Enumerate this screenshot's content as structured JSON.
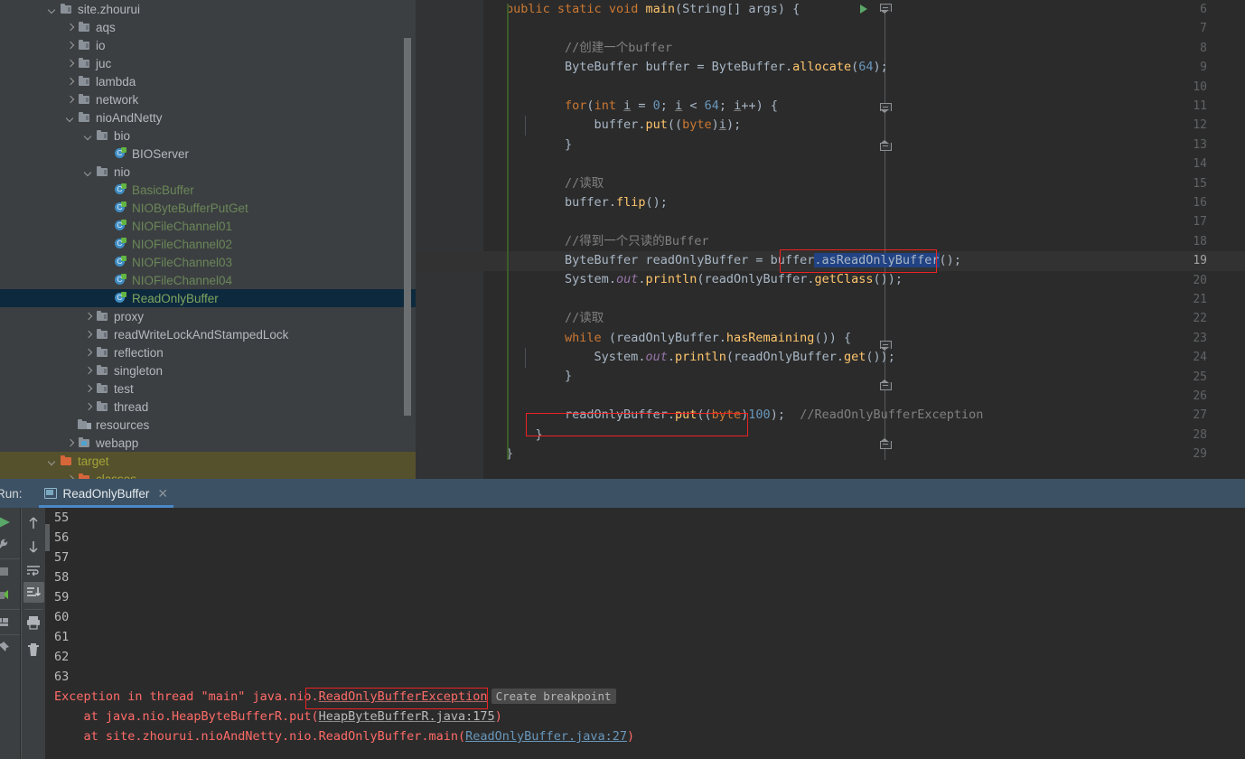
{
  "sidebar": {
    "scrollbar": "vertical-scrollbar",
    "items": [
      {
        "label": "site.zhourui",
        "indent": 0,
        "arrow": "down",
        "icon": "folder-icon",
        "kind": "folder"
      },
      {
        "label": "aqs",
        "indent": 1,
        "arrow": "right",
        "icon": "folder-icon",
        "kind": "folder"
      },
      {
        "label": "io",
        "indent": 1,
        "arrow": "right",
        "icon": "folder-icon",
        "kind": "folder"
      },
      {
        "label": "juc",
        "indent": 1,
        "arrow": "right",
        "icon": "folder-icon",
        "kind": "folder"
      },
      {
        "label": "lambda",
        "indent": 1,
        "arrow": "right",
        "icon": "folder-icon",
        "kind": "folder"
      },
      {
        "label": "network",
        "indent": 1,
        "arrow": "right",
        "icon": "folder-icon",
        "kind": "folder"
      },
      {
        "label": "nioAndNetty",
        "indent": 1,
        "arrow": "down",
        "icon": "folder-icon",
        "kind": "folder"
      },
      {
        "label": "bio",
        "indent": 2,
        "arrow": "down",
        "icon": "folder-icon",
        "kind": "folder"
      },
      {
        "label": "BIOServer",
        "indent": 3,
        "arrow": "none",
        "icon": "java-class-icon",
        "kind": "class"
      },
      {
        "label": "nio",
        "indent": 2,
        "arrow": "down",
        "icon": "folder-icon",
        "kind": "folder"
      },
      {
        "label": "BasicBuffer",
        "indent": 3,
        "arrow": "none",
        "icon": "java-class-icon",
        "kind": "class-green"
      },
      {
        "label": "NIOByteBufferPutGet",
        "indent": 3,
        "arrow": "none",
        "icon": "java-class-icon",
        "kind": "class-green"
      },
      {
        "label": "NIOFileChannel01",
        "indent": 3,
        "arrow": "none",
        "icon": "java-class-icon",
        "kind": "class-green"
      },
      {
        "label": "NIOFileChannel02",
        "indent": 3,
        "arrow": "none",
        "icon": "java-class-icon",
        "kind": "class-green"
      },
      {
        "label": "NIOFileChannel03",
        "indent": 3,
        "arrow": "none",
        "icon": "java-class-icon",
        "kind": "class-green"
      },
      {
        "label": "NIOFileChannel04",
        "indent": 3,
        "arrow": "none",
        "icon": "java-class-icon",
        "kind": "class-green"
      },
      {
        "label": "ReadOnlyBuffer",
        "indent": 3,
        "arrow": "none",
        "icon": "java-class-icon",
        "kind": "class-green",
        "selected": true
      },
      {
        "label": "proxy",
        "indent": 2,
        "arrow": "right",
        "icon": "folder-icon",
        "kind": "folder"
      },
      {
        "label": "readWriteLockAndStampedLock",
        "indent": 2,
        "arrow": "right",
        "icon": "folder-icon",
        "kind": "folder"
      },
      {
        "label": "reflection",
        "indent": 2,
        "arrow": "right",
        "icon": "folder-icon",
        "kind": "folder"
      },
      {
        "label": "singleton",
        "indent": 2,
        "arrow": "right",
        "icon": "folder-icon",
        "kind": "folder"
      },
      {
        "label": "test",
        "indent": 2,
        "arrow": "right",
        "icon": "folder-icon",
        "kind": "folder"
      },
      {
        "label": "thread",
        "indent": 2,
        "arrow": "right",
        "icon": "folder-icon",
        "kind": "folder"
      },
      {
        "label": "resources",
        "indent": 1,
        "arrow": "none",
        "icon": "resources-folder-icon",
        "kind": "resources"
      },
      {
        "label": "webapp",
        "indent": 1,
        "arrow": "right",
        "icon": "webapp-folder-icon",
        "kind": "webapp"
      },
      {
        "label": "target",
        "indent": 0,
        "arrow": "down",
        "icon": "folder-icon",
        "kind": "excluded"
      },
      {
        "label": "classes",
        "indent": 1,
        "arrow": "right",
        "icon": "folder-icon",
        "kind": "excluded"
      }
    ]
  },
  "editor": {
    "first_line": 6,
    "last_line": 29,
    "caret_line": 19,
    "run_gutter_line": 6,
    "lines": [
      {
        "n": 6,
        "text": "public static void main(String[] args) {"
      },
      {
        "n": 7,
        "text": ""
      },
      {
        "n": 8,
        "text": "        //创建一个buffer"
      },
      {
        "n": 9,
        "text": "        ByteBuffer buffer = ByteBuffer.allocate(64);"
      },
      {
        "n": 10,
        "text": ""
      },
      {
        "n": 11,
        "text": "        for(int i = 0; i < 64; i++) {"
      },
      {
        "n": 12,
        "text": "            buffer.put((byte)i);"
      },
      {
        "n": 13,
        "text": "        }"
      },
      {
        "n": 14,
        "text": ""
      },
      {
        "n": 15,
        "text": "        //读取"
      },
      {
        "n": 16,
        "text": "        buffer.flip();"
      },
      {
        "n": 17,
        "text": ""
      },
      {
        "n": 18,
        "text": "        //得到一个只读的Buffer"
      },
      {
        "n": 19,
        "text": "        ByteBuffer readOnlyBuffer = buffer.asReadOnlyBuffer();"
      },
      {
        "n": 20,
        "text": "        System.out.println(readOnlyBuffer.getClass());"
      },
      {
        "n": 21,
        "text": ""
      },
      {
        "n": 22,
        "text": "        //读取"
      },
      {
        "n": 23,
        "text": "        while (readOnlyBuffer.hasRemaining()) {"
      },
      {
        "n": 24,
        "text": "            System.out.println(readOnlyBuffer.get());"
      },
      {
        "n": 25,
        "text": "        }"
      },
      {
        "n": 26,
        "text": ""
      },
      {
        "n": 27,
        "text": "        readOnlyBuffer.put((byte)100);  //ReadOnlyBufferException"
      },
      {
        "n": 28,
        "text": "    }"
      },
      {
        "n": 29,
        "text": "}"
      }
    ],
    "selection": ".asReadOnlyBuffer",
    "annotations": [
      {
        "name": "annotation-box-asreadonlybuffer",
        "target": ".asReadOnlyBuffer();",
        "line": 19,
        "color": "#ee2222"
      },
      {
        "name": "annotation-box-put-call",
        "target": "readOnlyBuffer.put((byte)100);",
        "line": 27,
        "color": "#ee2222"
      }
    ]
  },
  "run_panel": {
    "label": "Run:",
    "tab_name": "ReadOnlyBuffer",
    "close_icon": "close-icon",
    "tab_icon": "console-icon",
    "toolbar_left": [
      "rerun-icon",
      "settings-icon",
      "stop-icon",
      "debug-icon",
      "layout-icon",
      "pin-icon"
    ],
    "toolbar_right": [
      "scroll-up-icon",
      "scroll-down-icon",
      "soft-wrap-icon",
      "scroll-to-end-icon",
      "print-icon",
      "trash-icon"
    ],
    "output": [
      {
        "text": "55",
        "type": "normal"
      },
      {
        "text": "56",
        "type": "normal"
      },
      {
        "text": "57",
        "type": "normal"
      },
      {
        "text": "58",
        "type": "normal"
      },
      {
        "text": "59",
        "type": "normal"
      },
      {
        "text": "60",
        "type": "normal"
      },
      {
        "text": "61",
        "type": "normal"
      },
      {
        "text": "62",
        "type": "normal"
      },
      {
        "text": "63",
        "type": "normal"
      }
    ],
    "exception": {
      "prefix": "Exception in thread \"main\" java.nio",
      "dot": ".",
      "name": "ReadOnlyBufferException",
      "breakpoint_chip": "Create breakpoint",
      "frames": [
        {
          "prefix": "    at java.nio.HeapByteBufferR.put(",
          "link": "HeapByteBufferR.java:175",
          "suffix": ")",
          "link_style": "grey"
        },
        {
          "prefix": "    at site.zhourui.nioAndNetty.nio.ReadOnlyBuffer.main(",
          "link": "ReadOnlyBuffer.java:27",
          "suffix": ")",
          "link_style": "blue"
        }
      ]
    }
  },
  "colors": {
    "editor_bg": "#2b2b2b",
    "gutter_bg": "#313335",
    "panel_bg": "#3c3f41",
    "selection_blue": "#214283",
    "tree_selection": "#0d293e",
    "excluded_bg": "#55512d",
    "annotation_red": "#ee2222",
    "error_red": "#ff6b68",
    "run_header_bg": "#3c5164",
    "accent_blue": "#4a88c7",
    "keyword_orange": "#cc7832",
    "string_green": "#6a8759",
    "number_blue": "#6897bb",
    "comment_grey": "#808080",
    "method_yellow": "#ffc66d",
    "field_purple": "#9876aa"
  }
}
